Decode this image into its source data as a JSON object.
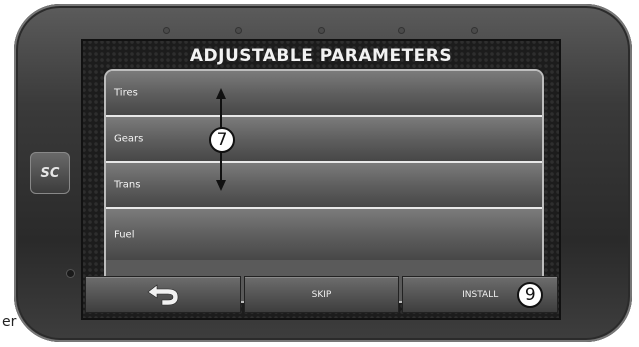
{
  "page_fragment_text": "er",
  "device": {
    "brand_logo": "SC"
  },
  "screen": {
    "title": "ADJUSTABLE PARAMETERS",
    "parameters": [
      {
        "label": "Tires"
      },
      {
        "label": "Gears"
      },
      {
        "label": "Trans"
      },
      {
        "label": "Fuel"
      }
    ],
    "annotations": {
      "scroll_callout": "7",
      "install_callout": "9"
    },
    "buttons": {
      "back_icon": "back-arrow-icon",
      "skip_label": "SKIP",
      "install_label": "INSTALL"
    }
  }
}
